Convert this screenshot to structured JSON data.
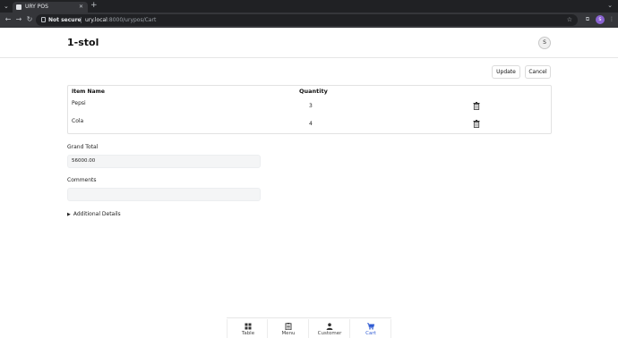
{
  "browser": {
    "tab_title": "URY POS",
    "security_label": "Not secure",
    "url_host": "ury.local",
    "url_rest": ":8000/urypos/Cart",
    "profile_initial": "s"
  },
  "header": {
    "title": "1-stol",
    "avatar_initial": "S"
  },
  "actions": {
    "update_label": "Update",
    "cancel_label": "Cancel"
  },
  "table": {
    "columns": {
      "name": "Item Name",
      "quantity": "Quantity"
    },
    "rows": [
      {
        "name": "Pepsi",
        "quantity": "3"
      },
      {
        "name": "Cola",
        "quantity": "4"
      }
    ]
  },
  "form": {
    "grand_total_label": "Grand Total",
    "grand_total_value": "56000.00",
    "comments_label": "Comments",
    "comments_value": "",
    "details_label": "Additional Details"
  },
  "bottom_nav": {
    "items": [
      {
        "label": "Table",
        "icon": "grid-icon"
      },
      {
        "label": "Menu",
        "icon": "menu-clipboard-icon"
      },
      {
        "label": "Customer",
        "icon": "person-icon"
      },
      {
        "label": "Cart",
        "icon": "cart-icon"
      }
    ],
    "active": "Cart",
    "active_color": "#2f5bd3"
  }
}
